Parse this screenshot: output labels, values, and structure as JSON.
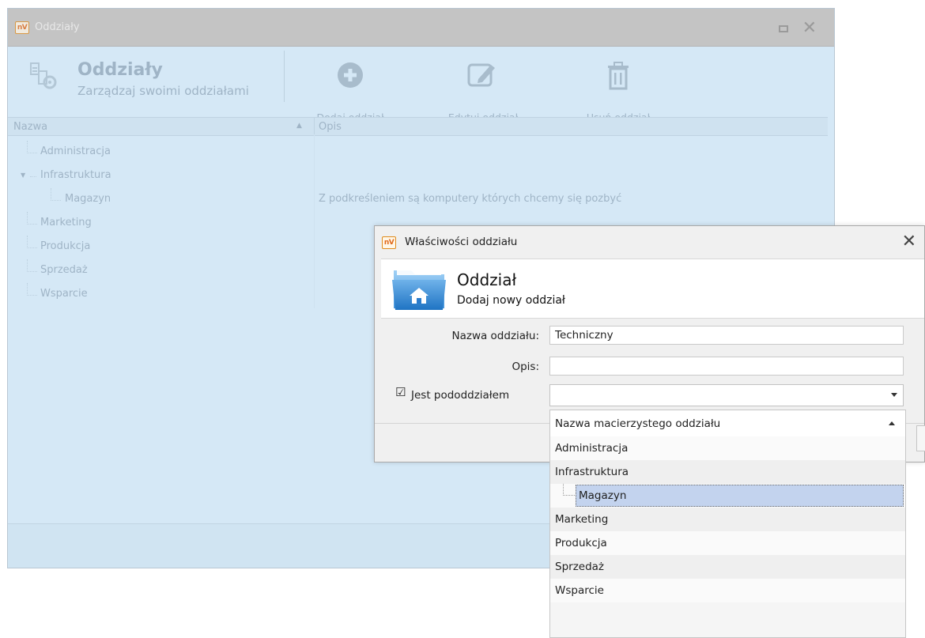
{
  "main_window": {
    "title": "Oddziały",
    "header_title": "Oddziały",
    "header_subtitle": "Zarządzaj swoimi oddziałami",
    "toolbar": {
      "add_label": "Dodaj oddział",
      "edit_label": "Edytuj oddział",
      "delete_label": "Usuń oddział"
    },
    "grid": {
      "col_name": "Nazwa",
      "col_desc": "Opis",
      "rows": [
        {
          "name": "Administracja",
          "desc": ""
        },
        {
          "name": "Infrastruktura",
          "desc": ""
        },
        {
          "name": "Magazyn",
          "desc": "Z podkreśleniem są komputery których chcemy się pozbyć"
        },
        {
          "name": "Marketing",
          "desc": ""
        },
        {
          "name": "Produkcja",
          "desc": ""
        },
        {
          "name": "Sprzedaż",
          "desc": ""
        },
        {
          "name": "Wsparcie",
          "desc": ""
        }
      ]
    }
  },
  "dialog": {
    "title": "Właściwości oddziału",
    "header_title": "Oddział",
    "header_subtitle": "Dodaj nowy oddział",
    "name_label": "Nazwa oddziału:",
    "name_value": "Techniczny",
    "desc_label": "Opis:",
    "desc_value": "",
    "subdept_label": "Jest pododdziałem",
    "subdept_checked": true
  },
  "dropdown": {
    "header": "Nazwa macierzystego oddziału",
    "items": [
      "Administracja",
      "Infrastruktura",
      "Magazyn",
      "Marketing",
      "Produkcja",
      "Sprzedaż",
      "Wsparcie"
    ],
    "selected": "Magazyn"
  },
  "colors": {
    "dim_bg": "#d5e8f6",
    "dim_text": "#9fb4c6",
    "selection": "#c3d3ee",
    "logo_orange": "#e0691a"
  }
}
